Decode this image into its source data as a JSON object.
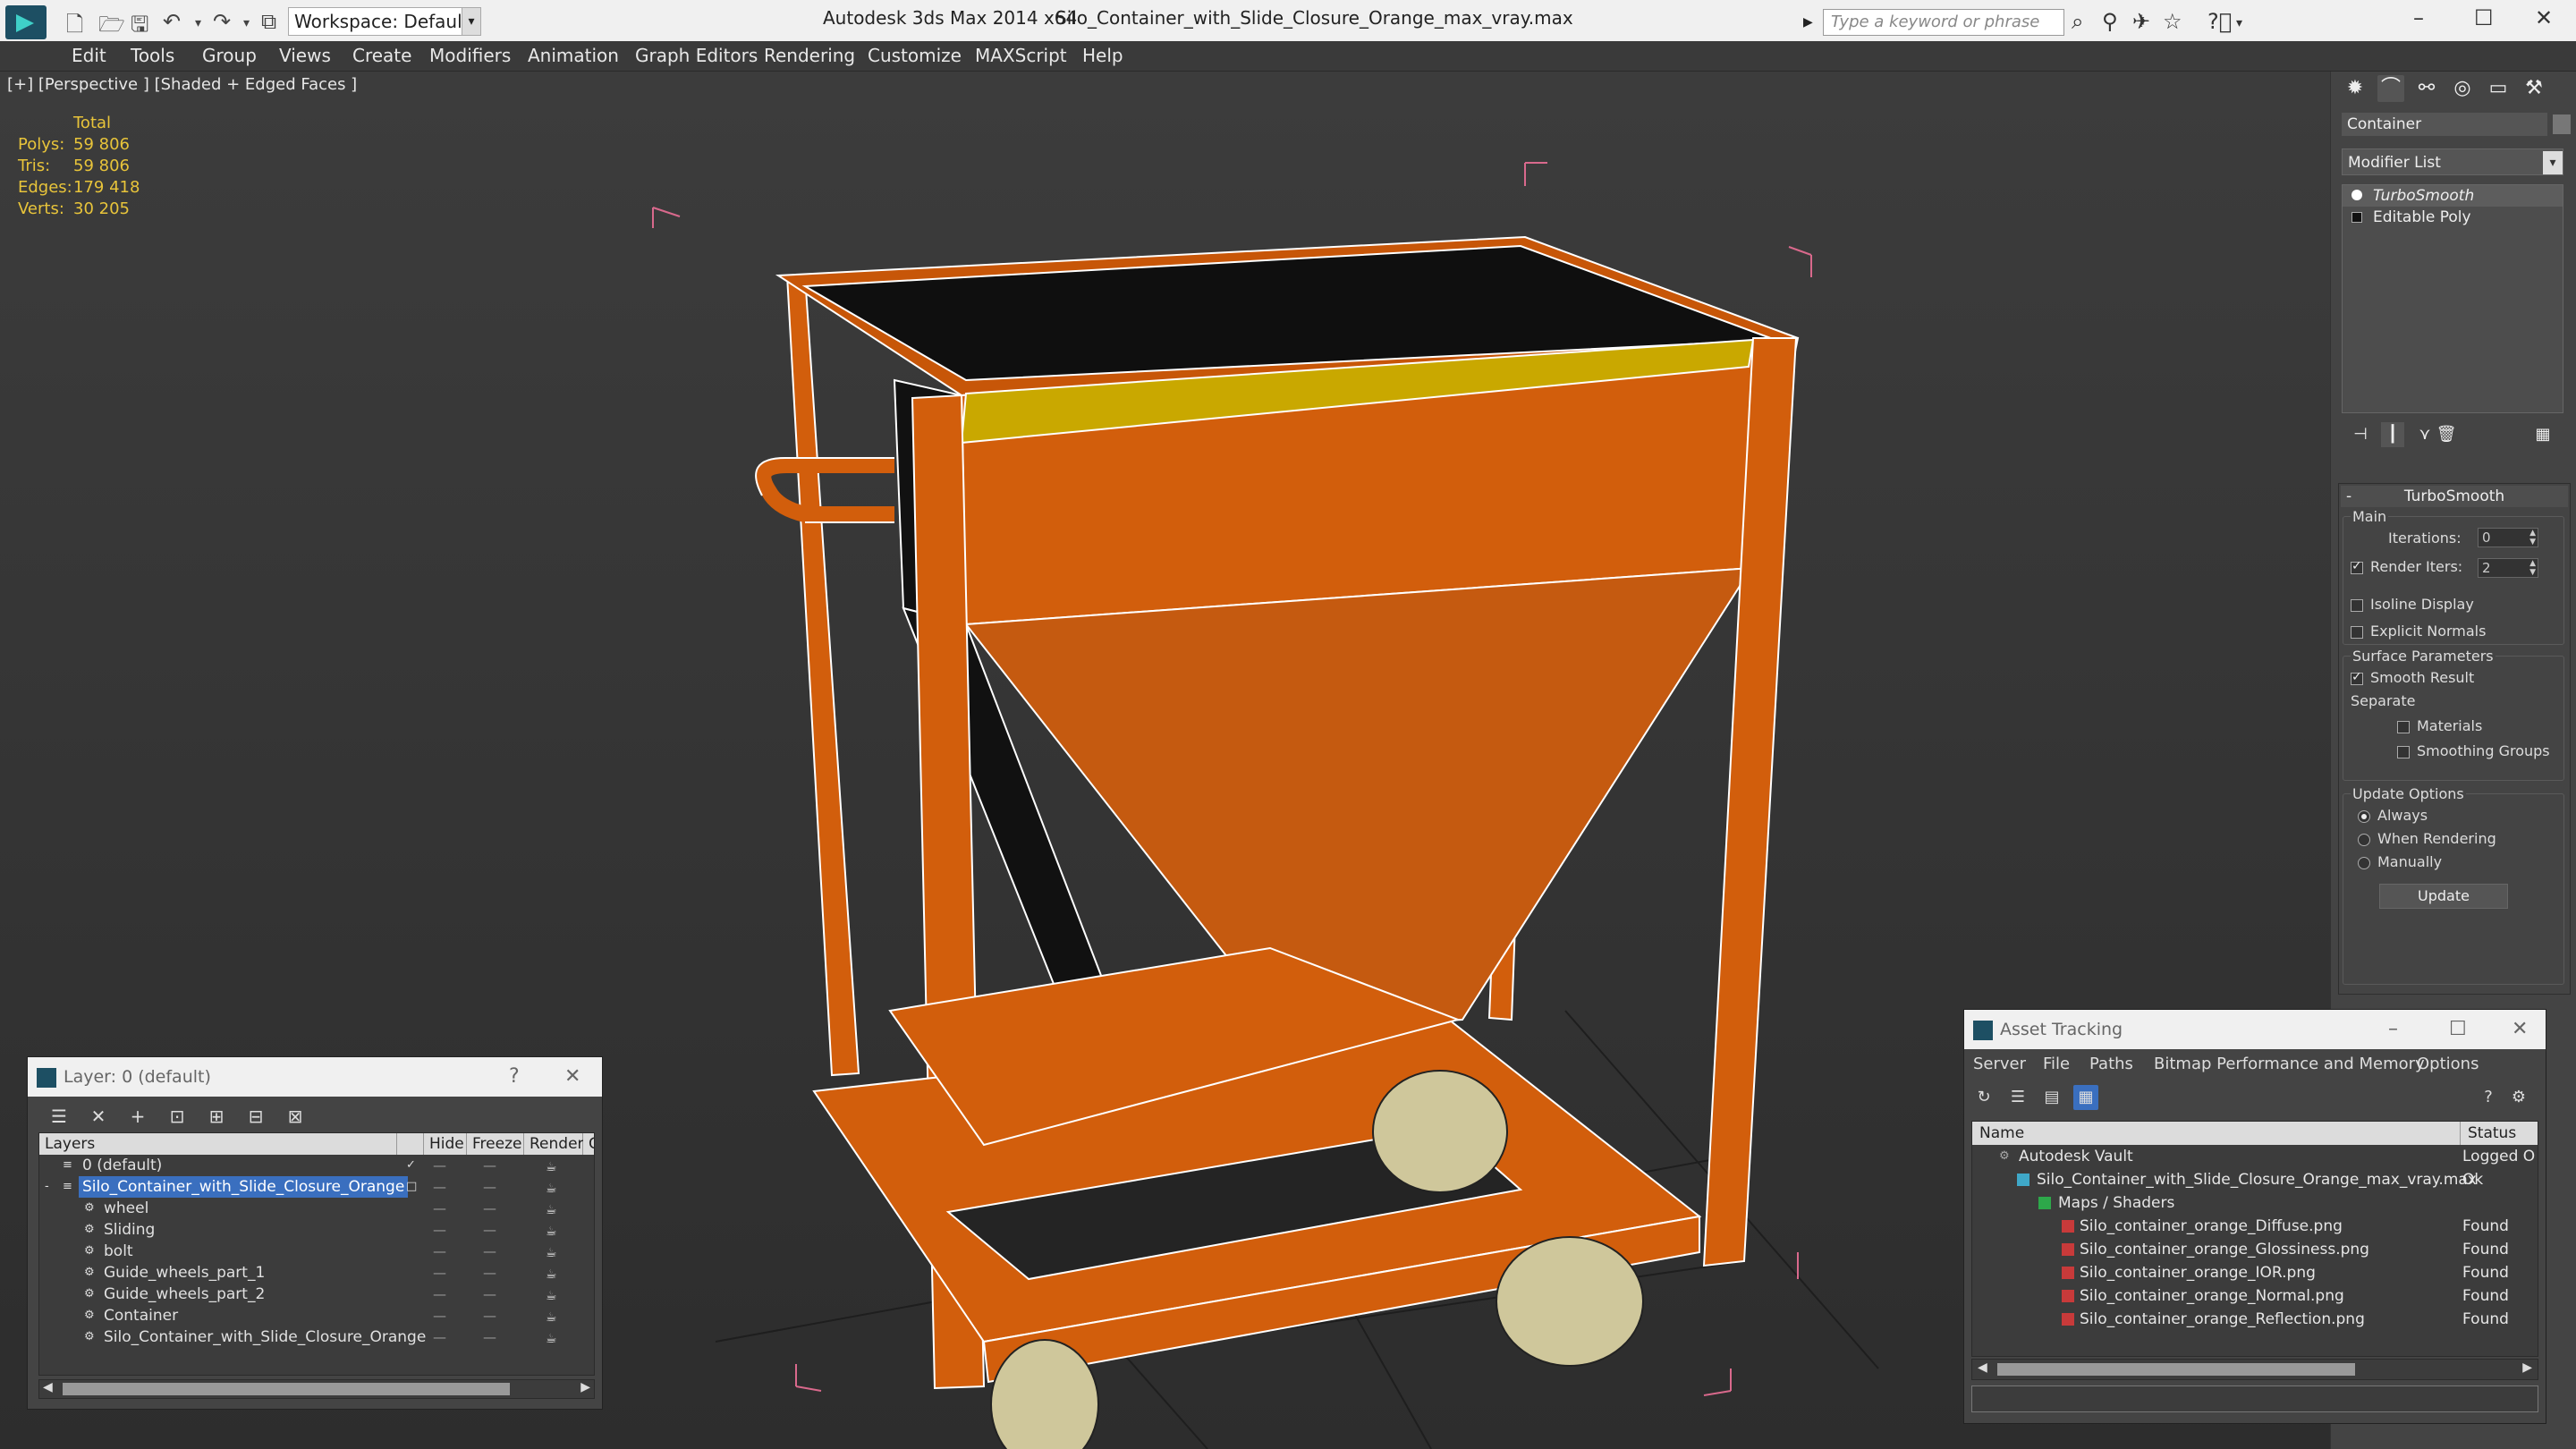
{
  "titlebar": {
    "workspace": "Workspace: Default",
    "app_title": "Autodesk 3ds Max  2014 x64",
    "file_title": "Silo_Container_with_Slide_Closure_Orange_max_vray.max",
    "search_placeholder": "Type a keyword or phrase"
  },
  "menubar": [
    "Edit",
    "Tools",
    "Group",
    "Views",
    "Create",
    "Modifiers",
    "Animation",
    "Graph Editors",
    "Rendering",
    "Customize",
    "MAXScript",
    "Help"
  ],
  "viewport": {
    "label": "[+] [Perspective ] [Shaded + Edged Faces ]",
    "stats": {
      "header": "Total",
      "polys_label": "Polys:",
      "polys": "59 806",
      "tris_label": "Tris:",
      "tris": "59 806",
      "edges_label": "Edges:",
      "edges": "179 418",
      "verts_label": "Verts:",
      "verts": "30 205"
    }
  },
  "command_panel": {
    "object_name": "Container",
    "modifier_list": "Modifier List",
    "stack": [
      "TurboSmooth",
      "Editable Poly"
    ],
    "turbosmooth": {
      "title": "TurboSmooth",
      "main_label": "Main",
      "iterations_label": "Iterations:",
      "iterations": "0",
      "render_iters_label": "Render Iters:",
      "render_iters": "2",
      "isoline": "Isoline Display",
      "explicit_normals": "Explicit Normals",
      "surface_params": "Surface Parameters",
      "smooth_result": "Smooth Result",
      "separate": "Separate",
      "materials": "Materials",
      "smoothing_groups": "Smoothing Groups",
      "update_options": "Update Options",
      "always": "Always",
      "when_rendering": "When Rendering",
      "manually": "Manually",
      "update_button": "Update"
    }
  },
  "layer_window": {
    "title": "Layer: 0 (default)",
    "help": "?",
    "columns": {
      "layers": "Layers",
      "hide": "Hide",
      "freeze": "Freeze",
      "render": "Render",
      "c": "C"
    },
    "rows": [
      "0 (default)",
      "Silo_Container_with_Slide_Closure_Orange",
      "wheel",
      "Sliding",
      "bolt",
      "Guide_wheels_part_1",
      "Guide_wheels_part_2",
      "Container",
      "Silo_Container_with_Slide_Closure_Orange"
    ]
  },
  "asset_window": {
    "title": "Asset Tracking",
    "menu": [
      "Server",
      "File",
      "Paths",
      "Bitmap Performance and Memory",
      "Options"
    ],
    "columns": {
      "name": "Name",
      "status": "Status"
    },
    "rows": [
      {
        "name": "Autodesk Vault",
        "status": "Logged O"
      },
      {
        "name": "Silo_Container_with_Slide_Closure_Orange_max_vray.max",
        "status": "Ok"
      },
      {
        "name": "Maps / Shaders",
        "status": ""
      },
      {
        "name": "Silo_container_orange_Diffuse.png",
        "status": "Found"
      },
      {
        "name": "Silo_container_orange_Glossiness.png",
        "status": "Found"
      },
      {
        "name": "Silo_container_orange_IOR.png",
        "status": "Found"
      },
      {
        "name": "Silo_container_orange_Normal.png",
        "status": "Found"
      },
      {
        "name": "Silo_container_orange_Reflection.png",
        "status": "Found"
      }
    ]
  },
  "colors": {
    "accent": "#3a6fbf",
    "object_orange": "#d25e0c",
    "stats_yellow": "#e8c43a"
  }
}
